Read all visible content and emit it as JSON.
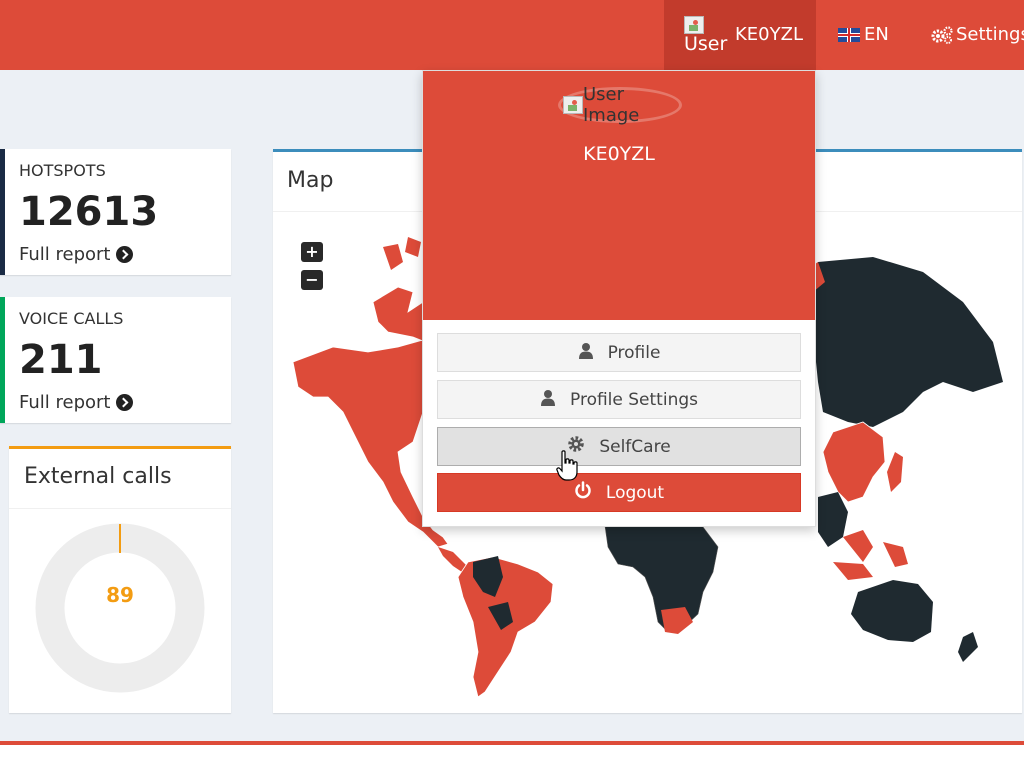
{
  "navbar": {
    "user_image_alt": "User",
    "username": "KE0YZL",
    "language": "EN",
    "settings_label": "Settings"
  },
  "stats": {
    "hotspots": {
      "label": "HOTSPOTS",
      "value": "12613",
      "link": "Full report",
      "color": "#1a2b45"
    },
    "voice_calls": {
      "label": "VOICE CALLS",
      "value": "211",
      "link": "Full report",
      "color": "#00a65a"
    }
  },
  "external_calls": {
    "title": "External calls",
    "value": "89",
    "color": "#f39c12"
  },
  "map": {
    "title": "Map",
    "zoom_in": "+",
    "zoom_out": "−",
    "highlight_color": "#dd4b39",
    "base_color": "#1f2a30"
  },
  "user_menu": {
    "image_alt": "User Image",
    "username": "KE0YZL",
    "items": [
      {
        "label": "Profile",
        "icon": "user-icon"
      },
      {
        "label": "Profile Settings",
        "icon": "user-icon"
      },
      {
        "label": "SelfCare",
        "icon": "gear-icon"
      },
      {
        "label": "Logout",
        "icon": "power-icon"
      }
    ]
  },
  "colors": {
    "primary": "#dd4b39",
    "accent_blue": "#3c8dbc",
    "warning": "#f39c12"
  }
}
